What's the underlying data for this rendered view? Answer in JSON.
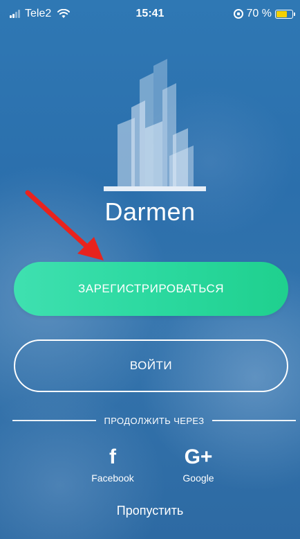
{
  "status_bar": {
    "carrier": "Tele2",
    "time": "15:41",
    "battery_percent": "70 %",
    "battery_level": 0.7,
    "battery_color": "#f5d000",
    "icons": [
      "signal-icon",
      "wifi-icon",
      "orientation-lock-icon",
      "battery-icon"
    ]
  },
  "app": {
    "name": "Darmen"
  },
  "buttons": {
    "register_label": "ЗАРЕГИСТРИРОВАТЬСЯ",
    "login_label": "ВОЙТИ"
  },
  "divider": {
    "label": "ПРОДОЛЖИТЬ ЧЕРЕЗ"
  },
  "social": {
    "facebook": {
      "icon_glyph": "f",
      "label": "Facebook"
    },
    "google": {
      "icon_glyph": "G+",
      "label": "Google"
    }
  },
  "skip_label": "Пропустить",
  "colors": {
    "background": "#2f78b4",
    "register_button": "#2cd9a0",
    "annotation_arrow": "#e8231e"
  }
}
